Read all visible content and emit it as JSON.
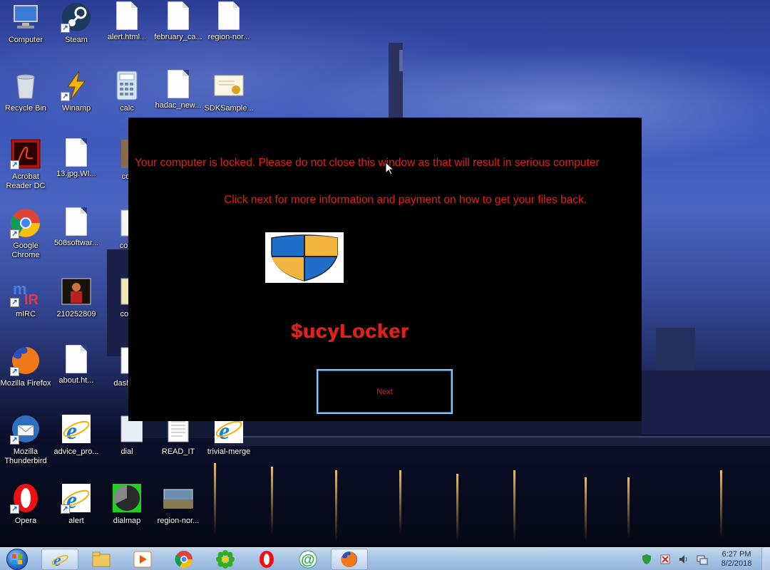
{
  "desktop": {
    "icons": [
      {
        "label": "Computer",
        "icon": "computer-icon"
      },
      {
        "label": "Steam",
        "icon": "steam-icon"
      },
      {
        "label": "alert.html...",
        "icon": "document-icon"
      },
      {
        "label": "february_ca...",
        "icon": "document-icon"
      },
      {
        "label": "region-nor...",
        "icon": "document-icon"
      },
      {
        "label": "Recycle Bin",
        "icon": "recycle-bin-icon"
      },
      {
        "label": "Winamp",
        "icon": "winamp-icon"
      },
      {
        "label": "calc",
        "icon": "calculator-icon"
      },
      {
        "label": "hadac_new...",
        "icon": "document-icon"
      },
      {
        "label": "SDKSample...",
        "icon": "certificate-icon"
      },
      {
        "label": "Acrobat Reader DC",
        "icon": "acrobat-icon"
      },
      {
        "label": "13.jpg.WI...",
        "icon": "document-icon"
      },
      {
        "label": "cof",
        "icon": "image-icon"
      },
      {
        "label": "Google Chrome",
        "icon": "chrome-icon"
      },
      {
        "label": "508softwar...",
        "icon": "document-icon"
      },
      {
        "label": "cont",
        "icon": "document-icon"
      },
      {
        "label": "mIRC",
        "icon": "mirc-icon"
      },
      {
        "label": "210252809",
        "icon": "photo-icon"
      },
      {
        "label": "corr",
        "icon": "document-icon"
      },
      {
        "label": "Mozilla Firefox",
        "icon": "firefox-icon"
      },
      {
        "label": "about.ht...",
        "icon": "document-icon"
      },
      {
        "label": "dashBo",
        "icon": "document-icon"
      },
      {
        "label": "Mozilla Thunderbird",
        "icon": "thunderbird-icon"
      },
      {
        "label": "advice_pro...",
        "icon": "ie-icon"
      },
      {
        "label": "dial",
        "icon": "document-icon"
      },
      {
        "label": "READ_IT",
        "icon": "text-file-icon"
      },
      {
        "label": "trivial-merge",
        "icon": "ie-icon"
      },
      {
        "label": "Opera",
        "icon": "opera-icon"
      },
      {
        "label": "alert",
        "icon": "ie-icon"
      },
      {
        "label": "dialmap",
        "icon": "dialmap-icon"
      },
      {
        "label": "region-nor...",
        "icon": "photo-icon"
      }
    ]
  },
  "locker": {
    "message_line1": "Your computer is locked. Please do not close this window as that will result in serious computer",
    "message_line2": "Click next for more information and payment on how to get your files back.",
    "brand": "$ucyLocker",
    "next_label": "Next",
    "text_color": "#e0201a"
  },
  "taskbar": {
    "pinned": [
      "ie-icon",
      "explorer-icon",
      "media-player-icon",
      "chrome-icon",
      "icq-icon",
      "opera-icon",
      "at-icon",
      "firefox-icon"
    ],
    "clock_time": "6:27 PM",
    "clock_date": "8/2/2018"
  }
}
